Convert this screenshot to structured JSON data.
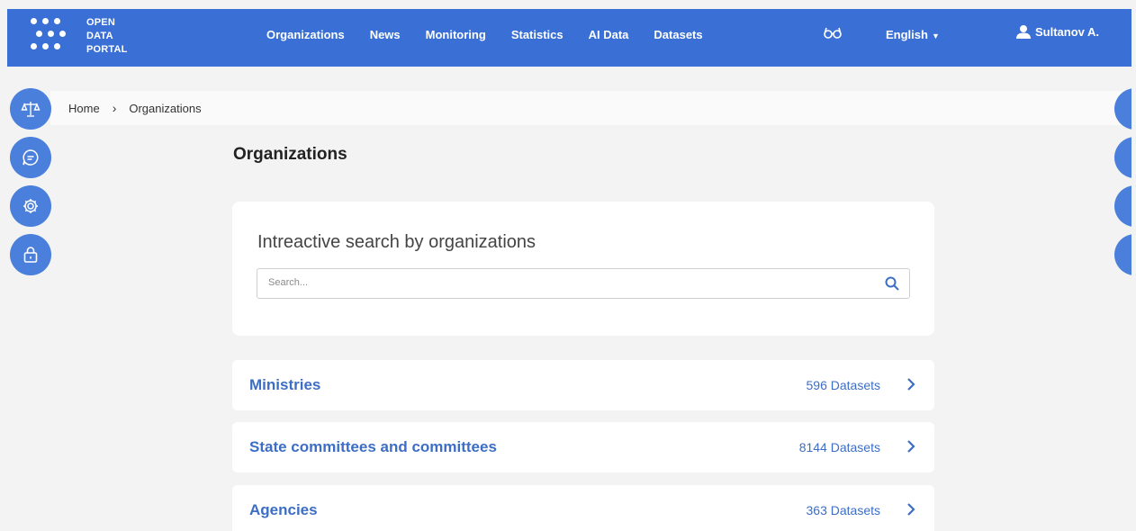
{
  "header": {
    "logo_lines": [
      "OPEN",
      "DATA",
      "PORTAL"
    ],
    "nav": [
      "Organizations",
      "News",
      "Monitoring",
      "Statistics",
      "AI Data",
      "Datasets"
    ],
    "accessibility_icon": "glasses-icon",
    "language": "English",
    "user_name": "Sultanov A."
  },
  "breadcrumb": {
    "home": "Home",
    "current": "Organizations"
  },
  "page": {
    "title": "Organizations"
  },
  "search": {
    "title": "Intreactive search by organizations",
    "placeholder": "Search...",
    "value": ""
  },
  "organizations": [
    {
      "name": "Ministries",
      "count": "596 Datasets"
    },
    {
      "name": "State committees and committees",
      "count": "8144 Datasets"
    },
    {
      "name": "Agencies",
      "count": "363 Datasets"
    }
  ],
  "left_sidebar_icons": [
    "scales-icon",
    "chat-icon",
    "settings-icon",
    "lock-icon"
  ],
  "colors": {
    "header": "#3a6fd6",
    "accent": "#3d6ec4",
    "background": "#f3f3f3"
  }
}
